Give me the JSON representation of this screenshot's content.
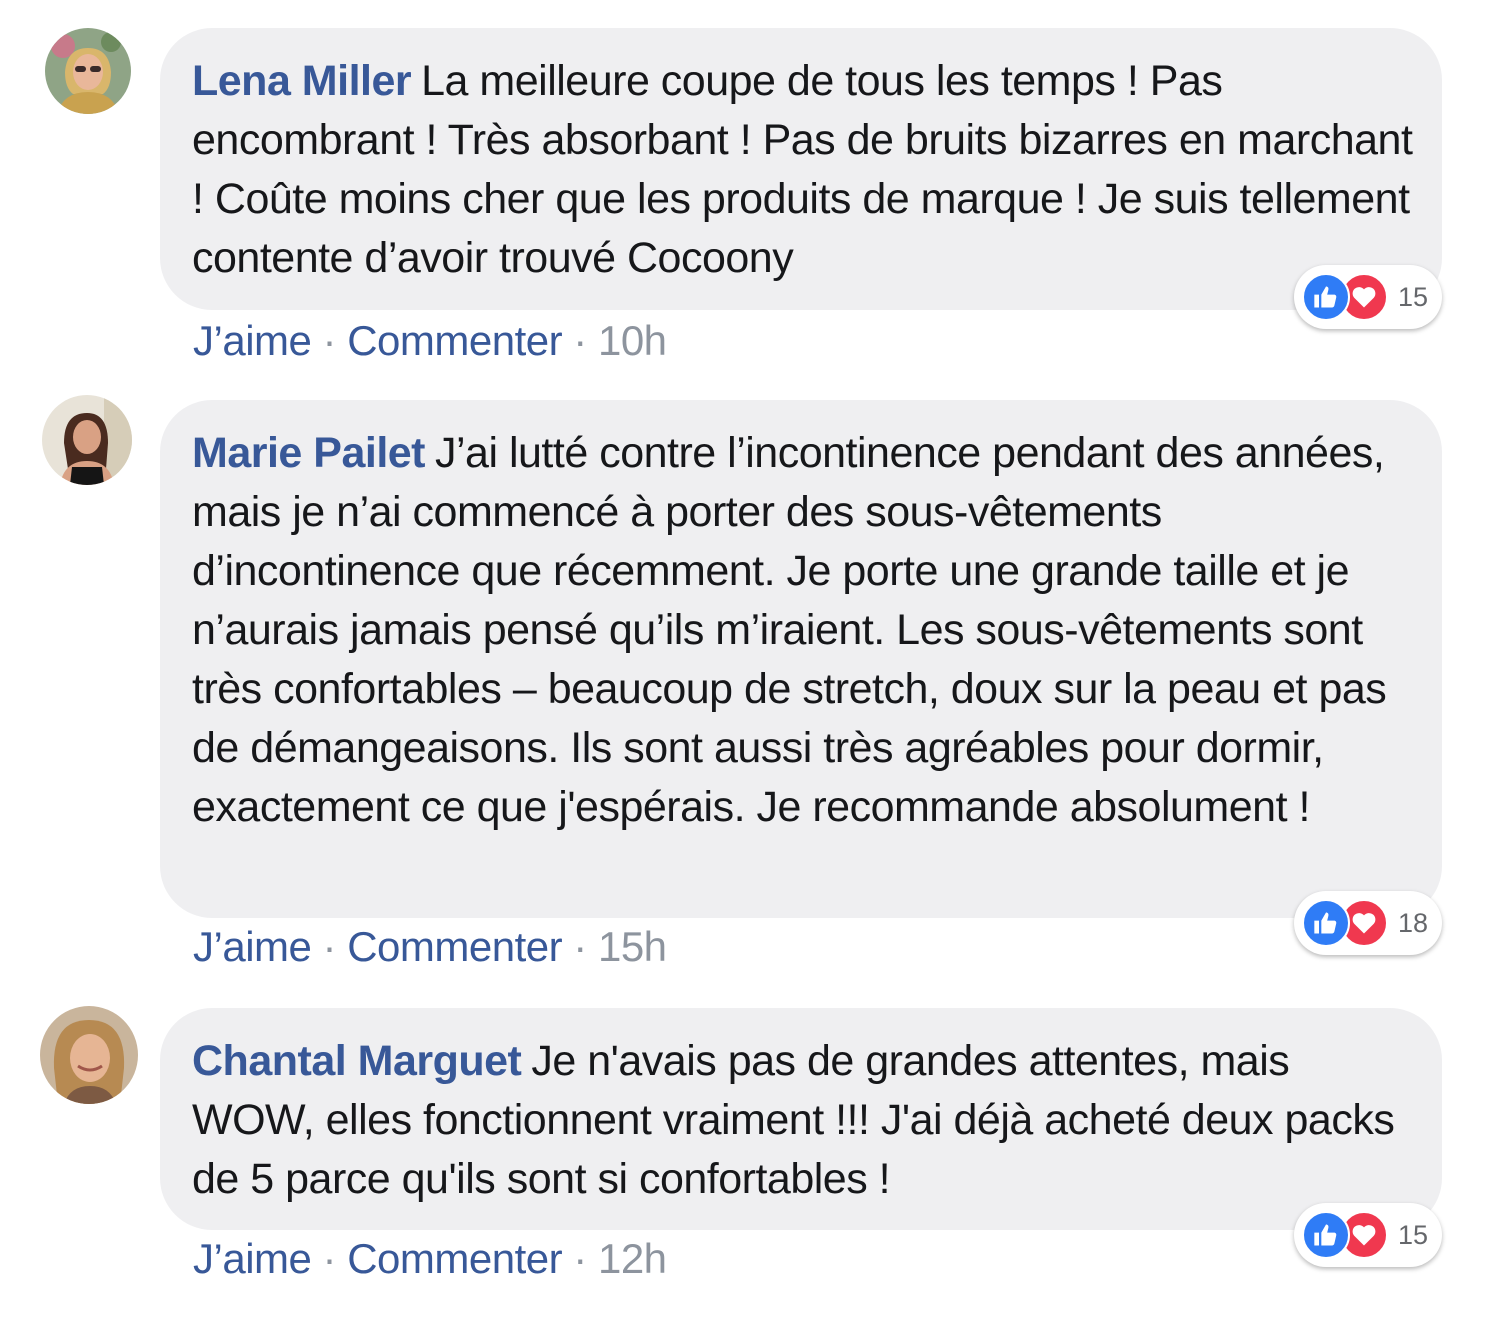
{
  "comments": [
    {
      "author": "Lena Miller",
      "text": "La meilleure coupe de tous les temps ! Pas encombrant ! Très absorbant ! Pas de bruits bizarres en marchant ! Coûte moins cher que les produits de marque ! Je suis tellement contente d’avoir trouvé Cocoony",
      "reaction_count": "15",
      "like_label": "J’aime",
      "separator": "·",
      "comment_label": "Commenter",
      "time": "10h"
    },
    {
      "author": "Marie Pailet",
      "text": "J’ai lutté contre l’incontinence pendant des années, mais je n’ai commencé à porter des sous-vêtements d’incontinence que récemment. Je porte une grande taille et je n’aurais jamais pensé qu’ils m’iraient. Les sous-vêtements sont très confortables – beaucoup de stretch, doux sur la peau et pas de démangeaisons. Ils sont aussi très agréables pour dormir, exactement ce que j'espérais. Je recommande absolument !",
      "reaction_count": "18",
      "like_label": "J’aime",
      "separator": "·",
      "comment_label": "Commenter",
      "time": "15h"
    },
    {
      "author": "Chantal Marguet",
      "text": "Je n'avais pas de grandes attentes, mais WOW, elles fonctionnent vraiment !!! J'ai déjà acheté deux packs de 5 parce qu'ils sont si confortables !",
      "reaction_count": "15",
      "like_label": "J’aime",
      "separator": "·",
      "comment_label": "Commenter",
      "time": "12h"
    }
  ],
  "icons": {
    "like": "thumbs-up-icon",
    "love": "heart-icon"
  },
  "colors": {
    "author_link": "#385898",
    "bubble_bg": "#efeff1",
    "like_blue": "#2f7cf6",
    "love_red": "#f0384f",
    "meta_gray": "#8d949e"
  }
}
